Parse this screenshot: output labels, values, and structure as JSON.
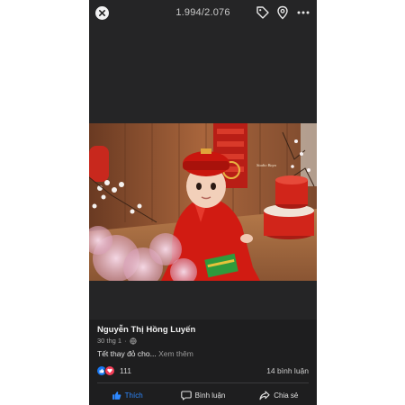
{
  "header": {
    "counter": "1.994/2.076",
    "icons": [
      "close-icon",
      "tag-icon",
      "location-pin-icon",
      "more-icon"
    ]
  },
  "photo": {
    "description_icon": "photo",
    "watermark": "Studio Baya"
  },
  "post": {
    "author": "Nguyễn Thị Hồng Luyến",
    "date": "30 thg 1",
    "separator": "·",
    "privacy_icon": "globe-icon",
    "caption": "Tết thay đỏ cho...",
    "see_more": "Xem thêm"
  },
  "stats": {
    "reaction_icons": [
      "like-reaction-icon",
      "love-reaction-icon"
    ],
    "reaction_count": "111",
    "comment_count": "14 bình luận"
  },
  "actions": {
    "like": "Thích",
    "comment": "Bình luận",
    "share": "Chia sẻ"
  },
  "colors": {
    "background": "#252526",
    "like_active": "#2d88ff",
    "love": "#f33e58",
    "like_badge": "#1877f2"
  }
}
